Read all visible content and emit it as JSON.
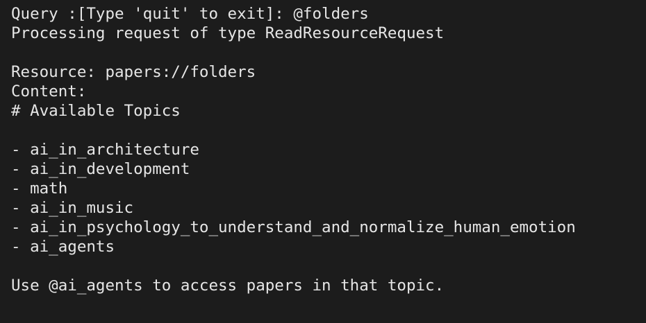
{
  "colors": {
    "background": "#1c1c1c",
    "text": "#e6e6e6"
  },
  "terminal": {
    "prompt_line": "Query :[Type 'quit' to exit]: @folders",
    "processing_line": "Processing request of type ReadResourceRequest",
    "resource_line": "Resource: papers://folders",
    "content_label": "Content:",
    "heading_line": "# Available Topics",
    "topics": [
      "- ai_in_architecture",
      "- ai_in_development",
      "- math",
      "- ai_in_music",
      "- ai_in_psychology_to_understand_and_normalize_human_emotion",
      "- ai_agents"
    ],
    "usage_line": "Use @ai_agents to access papers in that topic."
  }
}
